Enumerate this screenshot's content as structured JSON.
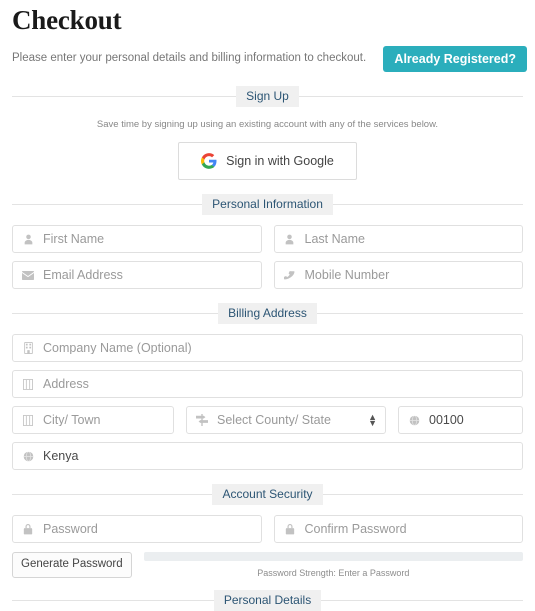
{
  "header": {
    "title": "Checkout",
    "subtitle": "Please enter your personal details and billing information to checkout.",
    "registered_button": "Already Registered?"
  },
  "theme": {
    "accent": "#2BAEBC",
    "divider_label_color": "#2c5574",
    "divider_label_bg": "#f0f0f0",
    "field_border": "#e0e0e0",
    "placeholder": "#9a9a9a"
  },
  "sections": {
    "sign_up": {
      "heading": "Sign Up",
      "note": "Save time by signing up using an existing account with any of the services below.",
      "google_button": "Sign in with Google"
    },
    "personal_information": {
      "heading": "Personal Information",
      "fields": [
        {
          "name": "first-name",
          "icon": "user-icon",
          "placeholder": "First Name",
          "value": ""
        },
        {
          "name": "last-name",
          "icon": "user-icon",
          "placeholder": "Last Name",
          "value": ""
        },
        {
          "name": "email-address",
          "icon": "envelope-icon",
          "placeholder": "Email Address",
          "value": ""
        },
        {
          "name": "mobile-number",
          "icon": "phone-icon",
          "placeholder": "Mobile Number",
          "value": ""
        }
      ]
    },
    "billing_address": {
      "heading": "Billing Address",
      "fields": [
        {
          "name": "company-name",
          "icon": "building-icon",
          "placeholder": "Company Name (Optional)",
          "value": ""
        },
        {
          "name": "address",
          "icon": "address-icon",
          "placeholder": "Address",
          "value": ""
        },
        {
          "name": "city-town",
          "icon": "address-icon",
          "placeholder": "City/ Town",
          "value": ""
        },
        {
          "name": "county-state",
          "icon": "map-signs-icon",
          "placeholder": "Select County/ State",
          "value": ""
        },
        {
          "name": "postal-code",
          "icon": "globe-icon",
          "placeholder": "",
          "value": "00100"
        },
        {
          "name": "country",
          "icon": "globe-icon",
          "placeholder": "",
          "value": "Kenya"
        }
      ]
    },
    "account_security": {
      "heading": "Account Security",
      "fields": [
        {
          "name": "password",
          "icon": "lock-icon",
          "placeholder": "Password",
          "value": ""
        },
        {
          "name": "confirm-password",
          "icon": "lock-icon",
          "placeholder": "Confirm Password",
          "value": ""
        }
      ],
      "generate_button": "Generate Password",
      "strength_label": "Password Strength: Enter a Password",
      "strength_percent": 0
    },
    "next_section": {
      "heading": "Personal Details"
    }
  }
}
